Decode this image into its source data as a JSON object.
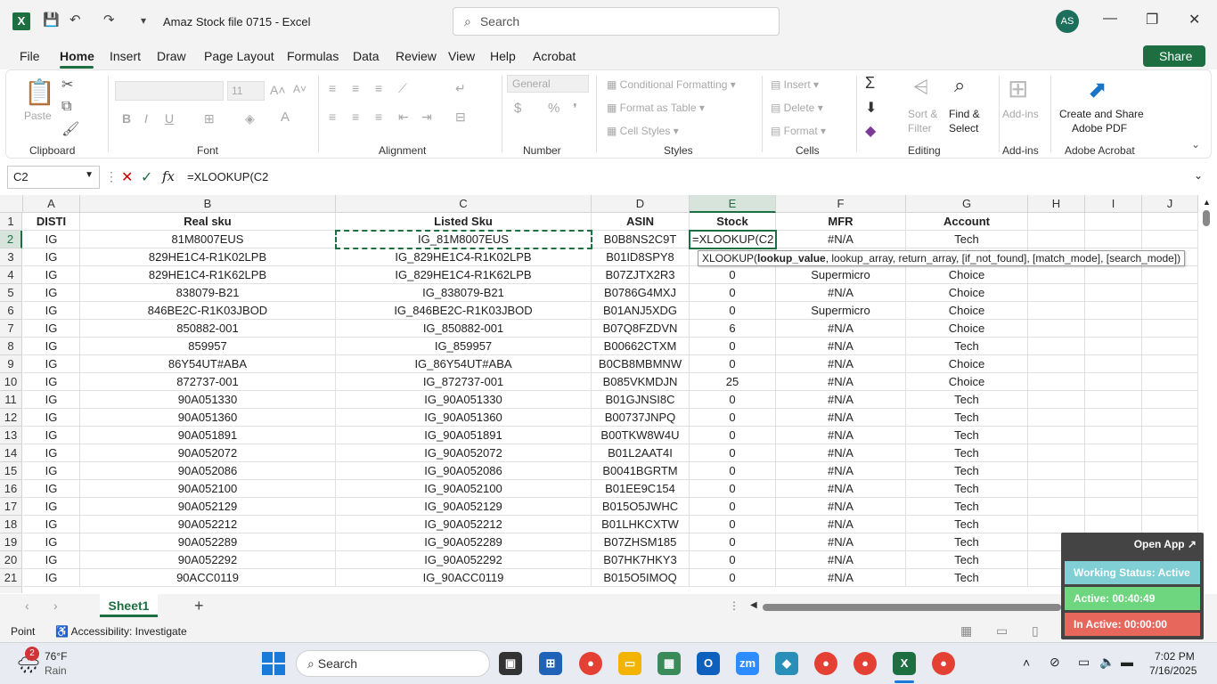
{
  "app": {
    "title": "Amaz Stock file 0715  -  Excel",
    "search_placeholder": "Search",
    "avatar": "AS"
  },
  "menu": {
    "items": [
      "File",
      "Home",
      "Insert",
      "Draw",
      "Page Layout",
      "Formulas",
      "Data",
      "Review",
      "View",
      "Help",
      "Acrobat"
    ],
    "active": "Home",
    "share": "Share"
  },
  "ribbon": {
    "clipboard": {
      "label": "Clipboard",
      "paste": "Paste"
    },
    "font": {
      "label": "Font",
      "size": "11"
    },
    "alignment": {
      "label": "Alignment"
    },
    "number": {
      "label": "Number",
      "format": "General"
    },
    "styles": {
      "label": "Styles",
      "conditional": "Conditional Formatting",
      "format_table": "Format as Table",
      "cell_styles": "Cell Styles"
    },
    "cells": {
      "label": "Cells",
      "insert": "Insert",
      "delete": "Delete",
      "format": "Format"
    },
    "editing": {
      "label": "Editing",
      "sort": "Sort &",
      "filter": "Filter",
      "find": "Find &",
      "select": "Select"
    },
    "addins": {
      "label": "Add-ins",
      "addins": "Add-ins"
    },
    "acrobat": {
      "label": "Adobe Acrobat",
      "create1": "Create and Share",
      "create2": "Adobe PDF"
    }
  },
  "formula_bar": {
    "name_box": "C2",
    "formula": "=XLOOKUP(C2"
  },
  "columns": [
    "A",
    "B",
    "C",
    "D",
    "E",
    "F",
    "G",
    "H",
    "I",
    "J"
  ],
  "header_row": [
    "DISTI",
    "Real sku",
    "Listed Sku",
    "ASIN",
    "Stock",
    "MFR",
    "Account"
  ],
  "rows": [
    {
      "n": "2",
      "c": [
        "IG",
        "81M8007EUS",
        "IG_81M8007EUS",
        "B0B8NS2C9T",
        "",
        "#N/A",
        "Tech"
      ]
    },
    {
      "n": "3",
      "c": [
        "IG",
        "829HE1C4-R1K02LPB",
        "IG_829HE1C4-R1K02LPB",
        "B01ID8SPY8",
        "",
        "",
        ""
      ]
    },
    {
      "n": "4",
      "c": [
        "IG",
        "829HE1C4-R1K62LPB",
        "IG_829HE1C4-R1K62LPB",
        "B07ZJTX2R3",
        "0",
        "Supermicro",
        "Choice"
      ]
    },
    {
      "n": "5",
      "c": [
        "IG",
        "838079-B21",
        "IG_838079-B21",
        "B0786G4MXJ",
        "0",
        "#N/A",
        "Choice"
      ]
    },
    {
      "n": "6",
      "c": [
        "IG",
        "846BE2C-R1K03JBOD",
        "IG_846BE2C-R1K03JBOD",
        "B01ANJ5XDG",
        "0",
        "Supermicro",
        "Choice"
      ]
    },
    {
      "n": "7",
      "c": [
        "IG",
        "850882-001",
        "IG_850882-001",
        "B07Q8FZDVN",
        "6",
        "#N/A",
        "Choice"
      ]
    },
    {
      "n": "8",
      "c": [
        "IG",
        "859957",
        "IG_859957",
        "B00662CTXM",
        "0",
        "#N/A",
        "Tech"
      ]
    },
    {
      "n": "9",
      "c": [
        "IG",
        "86Y54UT#ABA",
        "IG_86Y54UT#ABA",
        "B0CB8MBMNW",
        "0",
        "#N/A",
        "Choice"
      ]
    },
    {
      "n": "10",
      "c": [
        "IG",
        "872737-001",
        "IG_872737-001",
        "B085VKMDJN",
        "25",
        "#N/A",
        "Choice"
      ]
    },
    {
      "n": "11",
      "c": [
        "IG",
        "90A051330",
        "IG_90A051330",
        "B01GJNSI8C",
        "0",
        "#N/A",
        "Tech"
      ]
    },
    {
      "n": "12",
      "c": [
        "IG",
        "90A051360",
        "IG_90A051360",
        "B00737JNPQ",
        "0",
        "#N/A",
        "Tech"
      ]
    },
    {
      "n": "13",
      "c": [
        "IG",
        "90A051891",
        "IG_90A051891",
        "B00TKW8W4U",
        "0",
        "#N/A",
        "Tech"
      ]
    },
    {
      "n": "14",
      "c": [
        "IG",
        "90A052072",
        "IG_90A052072",
        "B01L2AAT4I",
        "0",
        "#N/A",
        "Tech"
      ]
    },
    {
      "n": "15",
      "c": [
        "IG",
        "90A052086",
        "IG_90A052086",
        "B0041BGRTM",
        "0",
        "#N/A",
        "Tech"
      ]
    },
    {
      "n": "16",
      "c": [
        "IG",
        "90A052100",
        "IG_90A052100",
        "B01EE9C154",
        "0",
        "#N/A",
        "Tech"
      ]
    },
    {
      "n": "17",
      "c": [
        "IG",
        "90A052129",
        "IG_90A052129",
        "B015O5JWHC",
        "0",
        "#N/A",
        "Tech"
      ]
    },
    {
      "n": "18",
      "c": [
        "IG",
        "90A052212",
        "IG_90A052212",
        "B01LHKCXTW",
        "0",
        "#N/A",
        "Tech"
      ]
    },
    {
      "n": "19",
      "c": [
        "IG",
        "90A052289",
        "IG_90A052289",
        "B07ZHSM185",
        "0",
        "#N/A",
        "Tech"
      ]
    },
    {
      "n": "20",
      "c": [
        "IG",
        "90A052292",
        "IG_90A052292",
        "B07HK7HKY3",
        "0",
        "#N/A",
        "Tech"
      ]
    },
    {
      "n": "21",
      "c": [
        "IG",
        "90ACC0119",
        "IG_90ACC0119",
        "B015O5IMOQ",
        "0",
        "#N/A",
        "Tech"
      ]
    }
  ],
  "active_cell_text": "=XLOOKUP(C2",
  "tooltip": {
    "fn": "XLOOKUP(",
    "bold": "lookup_value",
    "rest": ", lookup_array, return_array, [if_not_found], [match_mode], [search_mode])"
  },
  "sheet": {
    "tab": "Sheet1"
  },
  "status": {
    "mode": "Point",
    "accessibility": "Accessibility: Investigate"
  },
  "overlay": {
    "open_app": "Open App ↗",
    "working": "Working Status: Active",
    "active": "Active: 00:40:49",
    "inactive": "In Active: 00:00:00"
  },
  "taskbar": {
    "temp": "76°F",
    "weather": "Rain",
    "badge": "2",
    "search": "Search",
    "time": "7:02 PM",
    "date": "7/16/2025"
  }
}
